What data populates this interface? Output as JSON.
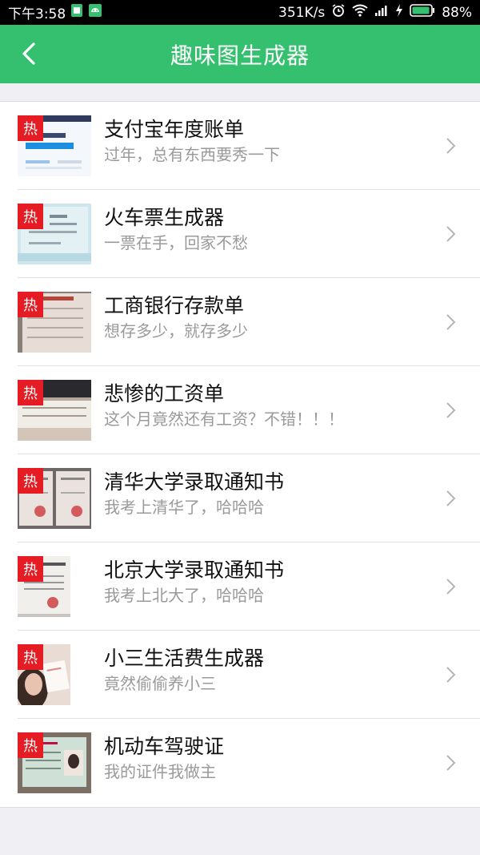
{
  "status_bar": {
    "time": "下午3:58",
    "speed": "351K/s",
    "battery": "88%",
    "icons": [
      "sim-card-icon",
      "android-icon",
      "alarm-icon",
      "wifi-icon",
      "signal-icon",
      "charging-icon",
      "battery-icon"
    ]
  },
  "app_bar": {
    "title": "趣味图生成器",
    "back_icon": "chevron-left-icon"
  },
  "badge_label": "热",
  "items": [
    {
      "title": "支付宝年度账单",
      "subtitle": "过年，总有东西要秀一下",
      "thumb_icon": "alipay-bill-thumbnail"
    },
    {
      "title": "火车票生成器",
      "subtitle": "一票在手，回家不愁",
      "thumb_icon": "train-ticket-thumbnail"
    },
    {
      "title": "工商银行存款单",
      "subtitle": "想存多少，就存多少",
      "thumb_icon": "bank-deposit-thumbnail"
    },
    {
      "title": "悲惨的工资单",
      "subtitle": "这个月竟然还有工资？不错！！！",
      "thumb_icon": "payslip-thumbnail"
    },
    {
      "title": "清华大学录取通知书",
      "subtitle": "我考上清华了，哈哈哈",
      "thumb_icon": "tsinghua-letter-thumbnail"
    },
    {
      "title": "北京大学录取通知书",
      "subtitle": "我考上北大了，哈哈哈",
      "thumb_icon": "peking-letter-thumbnail"
    },
    {
      "title": "小三生活费生成器",
      "subtitle": "竟然偷偷养小三",
      "thumb_icon": "photo-thumbnail"
    },
    {
      "title": "机动车驾驶证",
      "subtitle": "我的证件我做主",
      "thumb_icon": "driver-license-thumbnail"
    }
  ]
}
